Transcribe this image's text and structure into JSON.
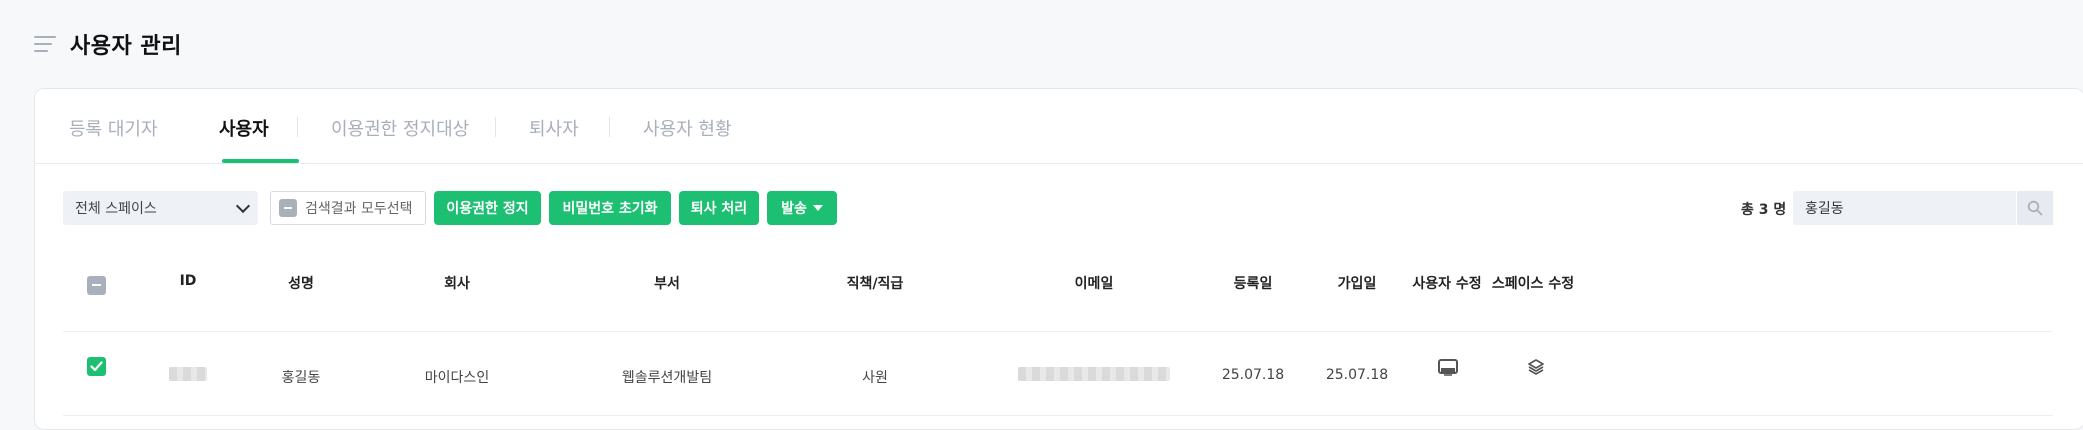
{
  "page": {
    "title": "사용자 관리"
  },
  "tabs": [
    {
      "label": "등록 대기자",
      "active": false
    },
    {
      "label": "사용자",
      "active": true
    },
    {
      "label": "이용권한 정지대상",
      "active": false
    },
    {
      "label": "퇴사자",
      "active": false
    },
    {
      "label": "사용자 현황",
      "active": false
    }
  ],
  "toolbar": {
    "space_select": "전체 스페이스",
    "select_all_label": "검색결과 모두선택",
    "suspend_button": "이용권한 정지",
    "reset_password_button": "비밀번호 초기화",
    "resign_button": "퇴사 처리",
    "send_button": "발송",
    "total_count": "총 3 명",
    "search_value": "홍길동"
  },
  "table": {
    "columns": [
      "ID",
      "성명",
      "회사",
      "부서",
      "직책/직급",
      "이메일",
      "등록일",
      "가입일",
      "사용자 수정",
      "스페이스 수정"
    ],
    "rows": [
      {
        "checked": true,
        "id": "",
        "name": "홍길동",
        "company": "마이다스인",
        "department": "웹솔루션개발팀",
        "position": "사원",
        "email": "",
        "registered": "25.07.18",
        "joined": "25.07.18"
      }
    ]
  },
  "colors": {
    "accent": "#1dbf73",
    "field_bg": "#eef1f6",
    "muted": "#a9b0bb"
  },
  "icons": {
    "menu": "menu-icon",
    "search": "search-icon",
    "edit_user": "monitor-icon",
    "edit_space": "layers-icon"
  }
}
